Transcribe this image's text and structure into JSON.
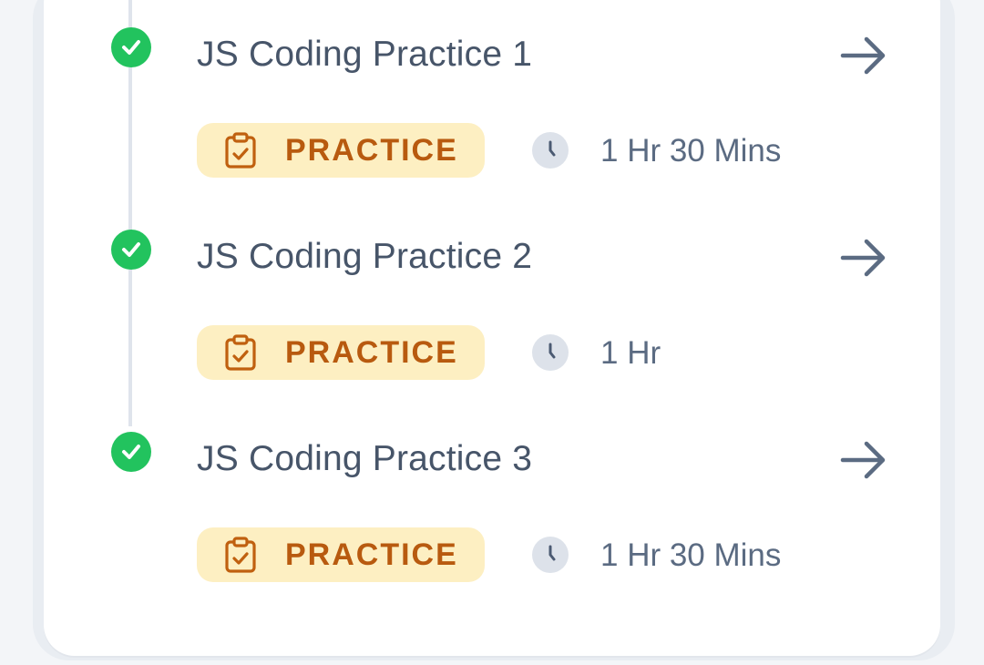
{
  "activities": [
    {
      "title": "JS Coding Practice 1",
      "status": "completed",
      "type_label": "PRACTICE",
      "duration": "1 Hr 30 Mins",
      "icons": {
        "status": "check-circle-icon",
        "type": "clipboard-check-icon",
        "duration": "clock-icon",
        "open": "arrow-right-icon"
      }
    },
    {
      "title": "JS Coding Practice 2",
      "status": "completed",
      "type_label": "PRACTICE",
      "duration": "1 Hr",
      "icons": {
        "status": "check-circle-icon",
        "type": "clipboard-check-icon",
        "duration": "clock-icon",
        "open": "arrow-right-icon"
      }
    },
    {
      "title": "JS Coding Practice 3",
      "status": "completed",
      "type_label": "PRACTICE",
      "duration": "1 Hr 30 Mins",
      "icons": {
        "status": "check-circle-icon",
        "type": "clipboard-check-icon",
        "duration": "clock-icon",
        "open": "arrow-right-icon"
      }
    }
  ],
  "colors": {
    "completed_green": "#22c35e",
    "badge_background": "#fdefc2",
    "badge_text": "#b85a0f",
    "title_text": "#475569",
    "duration_text": "#5b6b82"
  }
}
